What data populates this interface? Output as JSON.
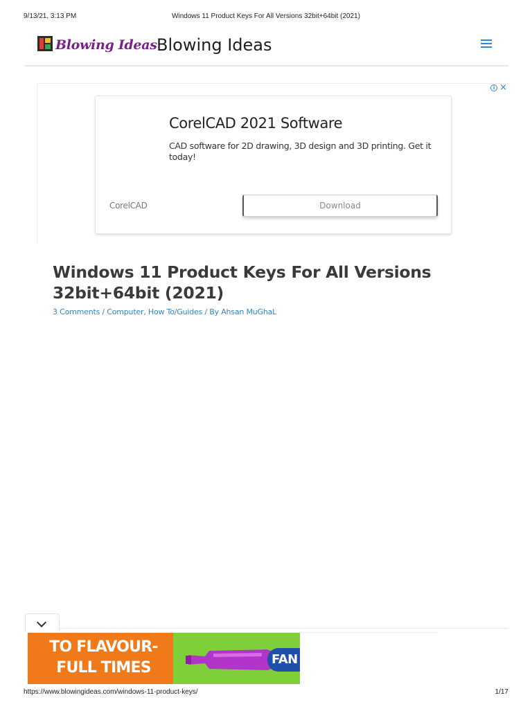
{
  "print_header": {
    "datetime": "9/13/21, 3:13 PM",
    "title": "Windows 11 Product Keys For All Versions 32bit+64bit (2021)"
  },
  "site": {
    "logo_text": "Blowing Ideas",
    "title": "Blowing Ideas",
    "logo_icon": "logo-icon",
    "menu_icon": "hamburger-menu-icon"
  },
  "ad": {
    "headline": "CorelCAD 2021 Software",
    "description": "CAD software for 2D drawing, 3D design and 3D printing. Get it today!",
    "brand": "CorelCAD",
    "cta": "Download",
    "info_icon_glyph": "i",
    "close_icon_glyph": "×"
  },
  "article": {
    "title": "Windows 11 Product Keys For All Versions 32bit+64bit (2021)",
    "meta": {
      "comments": "3 Comments",
      "sep1": " / ",
      "category1": "Computer",
      "comma": ", ",
      "category2": "How To/Guides",
      "by": " / By ",
      "author": "Ahsan MuGhaL"
    }
  },
  "bottom_ad": {
    "slogan": "TO FLAVOUR-FULL TIMES",
    "brand_fragment": "FAN"
  },
  "print_footer": {
    "url": "https://www.blowingideas.com/windows-11-product-keys/",
    "page": "1/17"
  },
  "colors": {
    "link": "#2f86c9",
    "logo_purple": "#7a1f8a",
    "ad_orange": "#f07a19",
    "ad_green": "#7fcf3a",
    "fanta_blue": "#1f4fa8"
  }
}
